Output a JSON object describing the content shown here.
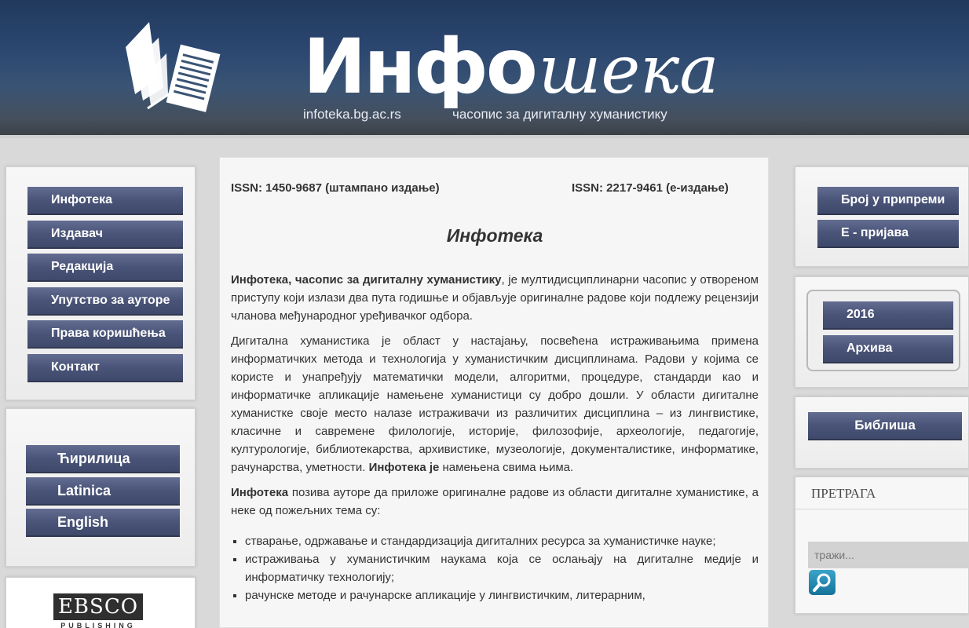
{
  "header": {
    "logo_bold": "Инфо",
    "logo_italic": "шека",
    "domain": "infoteka.bg.ac.rs",
    "subtitle": "часопис за дигиталну хуманистику"
  },
  "left_nav": {
    "items": [
      "Инфотека",
      "Издавач",
      "Редакција",
      "Упутство за ауторе",
      "Права коришћења",
      "Контакт"
    ]
  },
  "languages": {
    "items": [
      "Ћирилица",
      "Latinica",
      "English"
    ]
  },
  "ebsco": {
    "name": "EBSCO",
    "sub": "PUBLISHING"
  },
  "right_nav": {
    "top": [
      "Број у припреми",
      "Е - пријава"
    ],
    "archive": [
      "2016",
      "Архива"
    ],
    "biblisha": "Библиша",
    "search_title": "ПРЕТРАГА",
    "search_placeholder": "тражи..."
  },
  "content": {
    "issn_print": "ISSN: 1450-9687 (штампано издање)",
    "issn_online": "ISSN: 2217-9461 (е-издање)",
    "title": "Инфотека",
    "p1_bold": "Инфотека, часопис за дигиталну хуманистику",
    "p1_rest": ", је мултидисциплинарни часопис у отвореном приступу који излази два пута годишње и објављује оригиналне радове који подлежу рецензији чланова међународног уређивачког одбора.",
    "p2": "Дигитална хуманистика је област у настајању, посвећена истраживањима примена информатичких метода и технологија у хуманистичким дисциплинама. Радови у којима се користе и унапређују математички модели, алгоритми, процедуре, стандарди као и информатичке апликације намењене хуманистици су добро дошли. У области дигиталне хуманистке своје место налазе истраживачи из различитих дисциплина – из лингвистике, класичне и савремене филологије, историје, филозофије, археологије, педагогије, културологије, библиотекарства, архивистике, музеологије, документалистике, информатике, рачунарства, уметности.",
    "p2_bold": "Инфотека је",
    "p2_end": "намењена свима њима.",
    "p3_bold": "Инфотека",
    "p3_rest": "позива ауторе да приложе оригиналне радове из области дигиталне хуманистике, а неке од пожељних тема су:",
    "list": [
      "стварање, одржавање и стандардизација дигиталних ресурса за хуманистичке науке;",
      "истраживања у хуманистичким наукама која се ослањају на дигиталне медије и информатичку технологију;",
      "рачунске методе и рачунарске апликације у лингвистичким, литерарним,"
    ]
  }
}
